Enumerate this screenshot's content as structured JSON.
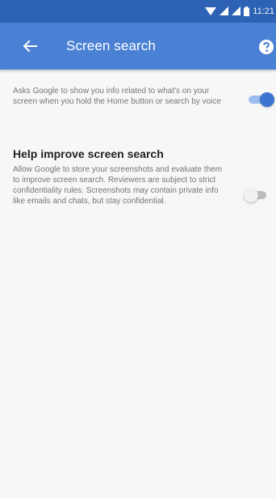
{
  "status_bar": {
    "time": "11:21",
    "color": "#2e62b4"
  },
  "app_bar": {
    "title": "Screen search",
    "back_icon": "arrow-back-icon",
    "help_icon": "help-icon",
    "color": "#4a81d4"
  },
  "settings": [
    {
      "title": "",
      "summary": "Asks Google to show you info related to what's on your screen when you hold the Home button or search by voice",
      "enabled": true
    },
    {
      "title": "Help improve screen search",
      "summary": "Allow Google to store your screenshots and evaluate them to improve screen search. Reviewers are subject to strict confidentiality rules. Screenshots may contain private info like emails and chats, but stay confidential.",
      "enabled": false
    }
  ],
  "colors": {
    "accent": "#3b73d0",
    "background": "#f7f7f7"
  }
}
